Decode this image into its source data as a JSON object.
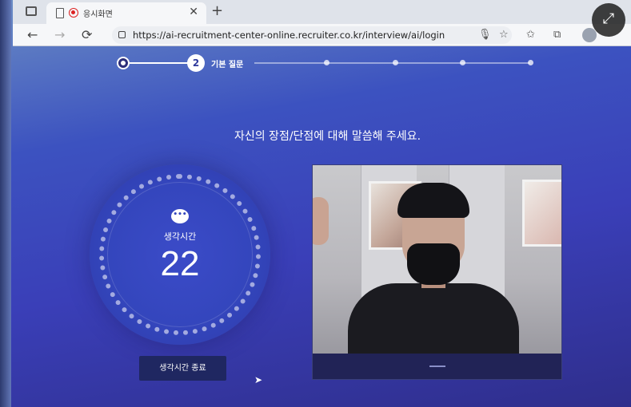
{
  "browser": {
    "tab_title": "응시화면",
    "tab_close": "✕",
    "new_tab": "+",
    "url": "https://ai-recruitment-center-online.recruiter.co.kr/interview/ai/login",
    "nav": {
      "back": "←",
      "forward": "→",
      "reload": "⟳"
    },
    "icons": [
      "mic-icon",
      "star-add-icon",
      "favorites-icon",
      "collections-icon",
      "profile-avatar"
    ],
    "expand": "⤢"
  },
  "stepper": {
    "current_step": "2",
    "current_label": "기본 질문",
    "total_dots": 5
  },
  "question": "자신의 장점/단점에 대해 말씀해 주세요.",
  "timer": {
    "icon": "•••",
    "label": "생각시간",
    "value": "22"
  },
  "end_button": "생각시간 종료",
  "colors": {
    "background_accent": "#3c52c0",
    "button": "#1f2761"
  }
}
